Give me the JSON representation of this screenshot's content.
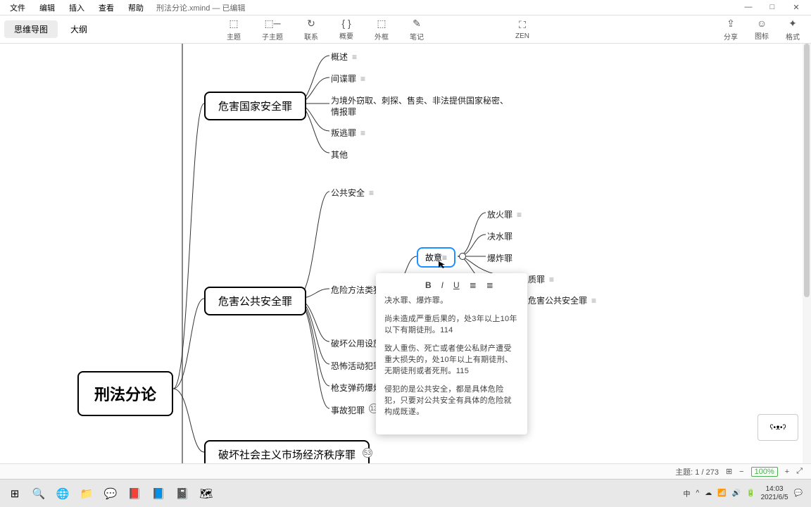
{
  "menu": {
    "file": "文件",
    "edit": "编辑",
    "insert": "插入",
    "view": "查看",
    "help": "帮助"
  },
  "window": {
    "filename": "刑法分论.xmind — 已编辑",
    "min": "—",
    "max": "□",
    "close": "✕"
  },
  "viewtabs": {
    "mindmap": "思维导图",
    "outline": "大纲"
  },
  "tools": {
    "topic": {
      "icon": "⬚",
      "label": "主题"
    },
    "subtopic": {
      "icon": "⬚─",
      "label": "子主题"
    },
    "relation": {
      "icon": "↻",
      "label": "联系"
    },
    "summary": {
      "icon": "{ }",
      "label": "概要"
    },
    "boundary": {
      "icon": "⬚",
      "label": "外框"
    },
    "note": {
      "icon": "✎",
      "label": "笔记"
    },
    "zen": {
      "icon": "⛶",
      "label": "ZEN"
    },
    "share": {
      "icon": "⇪",
      "label": "分享"
    },
    "iconset": {
      "icon": "☺",
      "label": "图标"
    },
    "format": {
      "icon": "✦",
      "label": "格式"
    }
  },
  "map": {
    "root": "刑法分论",
    "n1": "危害国家安全罪",
    "n1c": [
      "概述",
      "间谍罪",
      "为境外窃取、刺探、售卖、非法提供国家秘密、",
      "情报罪",
      "叛逃罪",
      "其他"
    ],
    "n2": "危害公共安全罪",
    "n2c": {
      "c1": "公共安全",
      "c2": "危险方法类犯",
      "c3": "破坏公用设施",
      "c4": "恐怖活动犯罪",
      "c5": "枪支弹药爆炸",
      "c6": "事故犯罪"
    },
    "intent": "故意",
    "intent_kids": [
      "放火罪",
      "决水罪",
      "爆炸罪",
      "质罪",
      "危害公共安全罪"
    ],
    "n3": "破坏社会主义市场经济秩序罪",
    "n3count": "53",
    "accident_count": "13"
  },
  "note": {
    "p1": "决水罪、爆炸罪。",
    "p2": "尚未造成严重后果的，处3年以上10年以下有期徒刑。114",
    "p3": "致人重伤、死亡或者使公私财产遭受重大损失的，处10年以上有期徒刑、无期徒刑或者死刑。115",
    "p4": "侵犯的是公共安全，都是具体危险犯，只要对公共安全有具体的危险就构成既遂。"
  },
  "status": {
    "topics": "主题: 1 / 273",
    "zoom": "100%"
  },
  "tray": {
    "ime": "中",
    "time": "14:03",
    "date": "2021/6/5"
  },
  "dog": "ʕ•ᴥ•ʔ"
}
